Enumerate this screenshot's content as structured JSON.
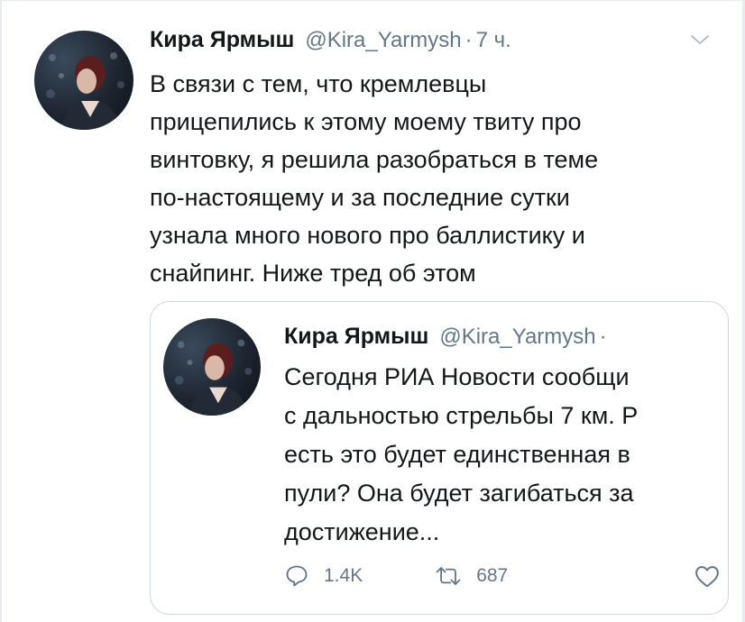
{
  "tweet": {
    "author_name": "Кира Ярмыш",
    "author_handle": "@Kira_Yarmysh",
    "separator": "·",
    "time": "7 ч.",
    "text_lines": [
      "В связи с тем, что кремлевцы",
      "прицепились к этому моему твиту про",
      "винтовку, я решила разобраться в теме",
      "по-настоящему и за последние сутки",
      "узнала много нового про баллистику и",
      "снайпинг. Ниже тред об этом"
    ]
  },
  "quoted_tweet": {
    "author_name": "Кира Ярмыш",
    "author_handle": "@Kira_Yarmysh",
    "separator": "·",
    "text_lines": [
      "Сегодня РИА Новости сообщи",
      "с дальностью стрельбы 7 км. Р",
      "есть это будет единственная в",
      "пули? Она будет загибаться за",
      "достижение..."
    ],
    "reply_count": "1.4K",
    "retweet_count": "687"
  },
  "icons": {
    "menu": "chevron-down-icon",
    "reply": "reply-icon",
    "retweet": "retweet-icon",
    "like": "heart-icon"
  },
  "colors": {
    "text": "#14171a",
    "secondary": "#657786",
    "border": "#ccd6dd"
  }
}
